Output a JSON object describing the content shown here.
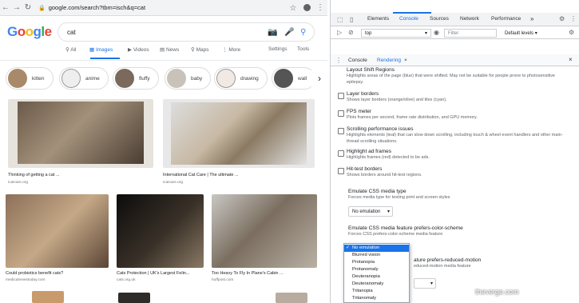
{
  "browser": {
    "url": "google.com/search?tbm=isch&q=cat"
  },
  "google": {
    "logo": "Google",
    "query": "cat",
    "tabs": [
      {
        "label": "All"
      },
      {
        "label": "Images"
      },
      {
        "label": "Videos"
      },
      {
        "label": "News"
      },
      {
        "label": "Maps"
      },
      {
        "label": "More"
      }
    ],
    "settings_label": "Settings",
    "tools_label": "Tools",
    "chips": [
      "kitten",
      "anime",
      "fluffy",
      "baby",
      "drawing",
      "wall"
    ],
    "results": [
      {
        "caption": "Thinking of getting a cat ...",
        "source": "icatcare.org"
      },
      {
        "caption": "International Cat Care | The ultimate ...",
        "source": "icatcare.org"
      },
      {
        "caption": "Could probiotics benefit cats?",
        "source": "medicalnewstoday.com"
      },
      {
        "caption": "Cats Protection | UK's Largest Felin...",
        "source": "cats.org.uk"
      },
      {
        "caption": "Too Heavy To Fly In Plane's Cabin ...",
        "source": "huffpost.com"
      }
    ]
  },
  "devtools": {
    "top_tabs": [
      "Elements",
      "Console",
      "Sources",
      "Network",
      "Performance",
      "»"
    ],
    "context": "top",
    "filter_placeholder": "Filter",
    "levels": "Default levels",
    "drawer_tabs": [
      "Console",
      "Rendering"
    ],
    "drawer_close": "×",
    "options": [
      {
        "title": "Layout Shift Regions",
        "desc": "Highlights areas of the page (blue) that were shifted. May not be suitable for people prone to photosensitive epilepsy."
      },
      {
        "title": "Layer borders",
        "desc": "Shows layer borders (orange/olive) and tiles (cyan)."
      },
      {
        "title": "FPS meter",
        "desc": "Plots frames per second, frame rate distribution, and GPU memory."
      },
      {
        "title": "Scrolling performance issues",
        "desc": "Highlights elements (teal) that can slow down scrolling, including touch & wheel event handlers and other main-thread scrolling situations."
      },
      {
        "title": "Highlight ad frames",
        "desc": "Highlights frames (red) detected to be ads."
      },
      {
        "title": "Hit-test borders",
        "desc": "Shows borders around hit-test regions."
      }
    ],
    "media_type": {
      "title": "Emulate CSS media type",
      "desc": "Forces media type for testing print and screen styles",
      "value": "No emulation"
    },
    "color_scheme": {
      "title": "Emulate CSS media feature prefers-color-scheme",
      "desc": "Forces CSS prefers-color-scheme media feature"
    },
    "reduced_motion": {
      "title": "Emulate CSS media feature prefers-reduced-motion",
      "desc": "Forces CSS prefers-reduced-motion media feature"
    },
    "vision_menu": [
      "No emulation",
      "Blurred vision",
      "Protanopia",
      "Protanomaly",
      "Deuteranopia",
      "Deuteranomaly",
      "Tritanopia",
      "Tritanomaly"
    ]
  },
  "watermark": "theverge.com"
}
